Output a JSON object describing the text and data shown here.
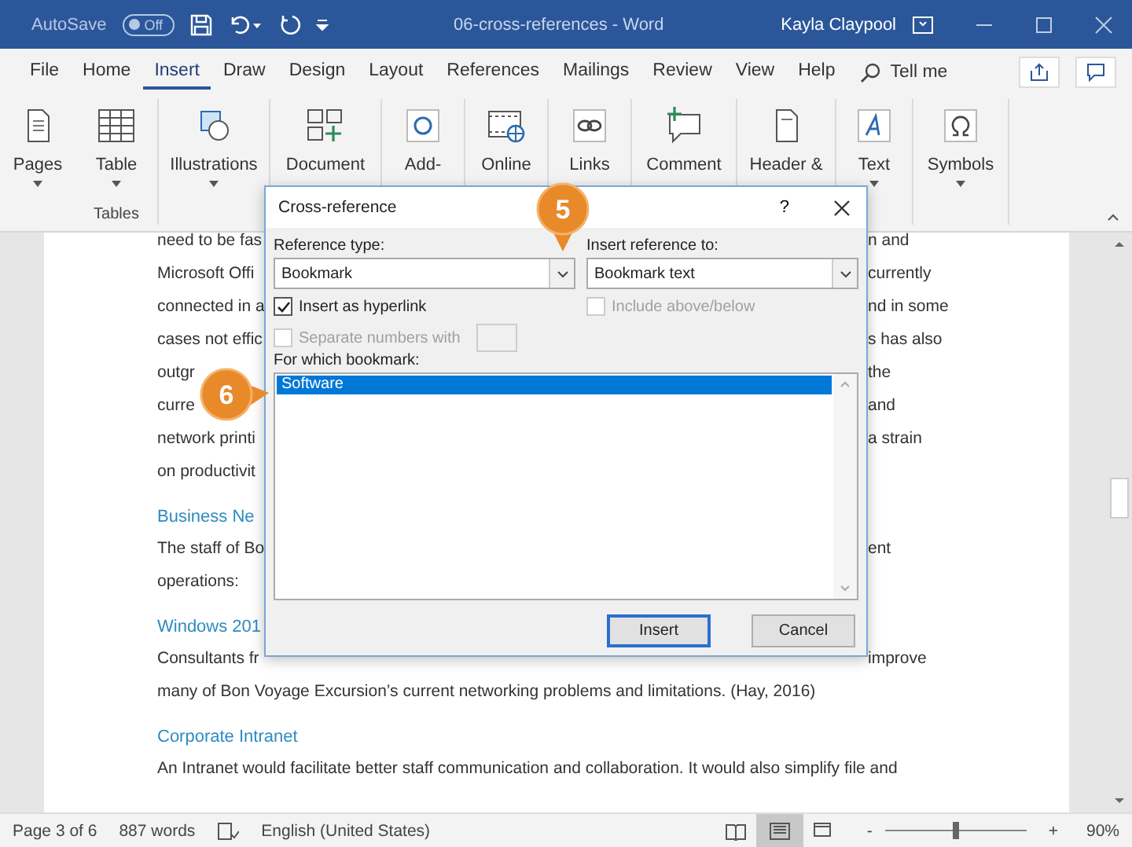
{
  "title_bar": {
    "autosave_label": "AutoSave",
    "autosave_state": "Off",
    "title": "06-cross-references - Word",
    "user": "Kayla Claypool"
  },
  "tabs": [
    {
      "label": "File",
      "selected": false
    },
    {
      "label": "Home",
      "selected": false
    },
    {
      "label": "Insert",
      "selected": true
    },
    {
      "label": "Draw",
      "selected": false
    },
    {
      "label": "Design",
      "selected": false
    },
    {
      "label": "Layout",
      "selected": false
    },
    {
      "label": "References",
      "selected": false
    },
    {
      "label": "Mailings",
      "selected": false
    },
    {
      "label": "Review",
      "selected": false
    },
    {
      "label": "View",
      "selected": false
    },
    {
      "label": "Help",
      "selected": false
    }
  ],
  "tell_me": "Tell me",
  "ribbon": [
    {
      "label": "Pages",
      "caret": true
    },
    {
      "label": "Table",
      "caret": true,
      "caption": "Tables"
    },
    {
      "label": "Illustrations",
      "caret": true
    },
    {
      "label": "Document",
      "caret": false
    },
    {
      "label": "Add-",
      "caret": false
    },
    {
      "label": "Online",
      "caret": false
    },
    {
      "label": "Links",
      "caret": false
    },
    {
      "label": "Comment",
      "caret": false
    },
    {
      "label": "Header &",
      "caret": false
    },
    {
      "label": "Text",
      "caret": true
    },
    {
      "label": "Symbols",
      "caret": true
    }
  ],
  "document": [
    {
      "kind": "body",
      "left": "need to be fas",
      "right": "n and"
    },
    {
      "kind": "body",
      "left": "Microsoft Offi",
      "right": "currently"
    },
    {
      "kind": "body",
      "left": "connected in a",
      "right": "nd in some"
    },
    {
      "kind": "body",
      "left": "cases not effic",
      "right": "s has also"
    },
    {
      "kind": "body",
      "left": "outgr",
      "right": "the"
    },
    {
      "kind": "body",
      "left": "curre",
      "right": "and"
    },
    {
      "kind": "body",
      "left": "network printi",
      "right": "a strain"
    },
    {
      "kind": "body",
      "left": "on productivit"
    },
    {
      "kind": "heading",
      "left": "Business Ne"
    },
    {
      "kind": "body",
      "left": "The staff of Bo",
      "right": "ent"
    },
    {
      "kind": "body",
      "left": "operations:"
    },
    {
      "kind": "heading",
      "left": "Windows 201"
    },
    {
      "kind": "body",
      "left": "Consultants fr",
      "right": "improve"
    },
    {
      "kind": "body",
      "text": "many of Bon Voyage Excursion’s current networking problems and limitations. (Hay, 2016)"
    },
    {
      "kind": "heading",
      "text": "Corporate Intranet"
    },
    {
      "kind": "body",
      "text": "An Intranet would facilitate better staff communication and collaboration. It would also simplify file and"
    }
  ],
  "dialog": {
    "title": "Cross-reference",
    "help": "?",
    "reference_type": {
      "label": "Reference type:",
      "value": "Bookmark"
    },
    "insert_reference_to": {
      "label": "Insert reference to:",
      "value": "Bookmark text"
    },
    "options": [
      {
        "label": "Insert as hyperlink",
        "checked": true,
        "disabled": false
      },
      {
        "label": "Include above/below",
        "checked": false,
        "disabled": true
      },
      {
        "label": "Separate numbers with",
        "checked": false,
        "disabled": true
      }
    ],
    "list_label": "For which bookmark:",
    "bookmarks": [
      {
        "label": "Software",
        "selected": true
      }
    ],
    "buttons": [
      {
        "label": "Insert",
        "default": true
      },
      {
        "label": "Cancel",
        "default": false
      }
    ]
  },
  "callouts": [
    {
      "label": "5"
    },
    {
      "label": "6"
    }
  ],
  "status_bar": {
    "page": "Page 3 of 6",
    "words": "887 words",
    "language": "English (United States)",
    "views": [
      {
        "kind": "read",
        "selected": false
      },
      {
        "kind": "print",
        "selected": true
      },
      {
        "kind": "web",
        "selected": false
      }
    ],
    "zoom": {
      "minus": "-",
      "plus": "+",
      "level": 0.5,
      "reading": "90%"
    }
  }
}
